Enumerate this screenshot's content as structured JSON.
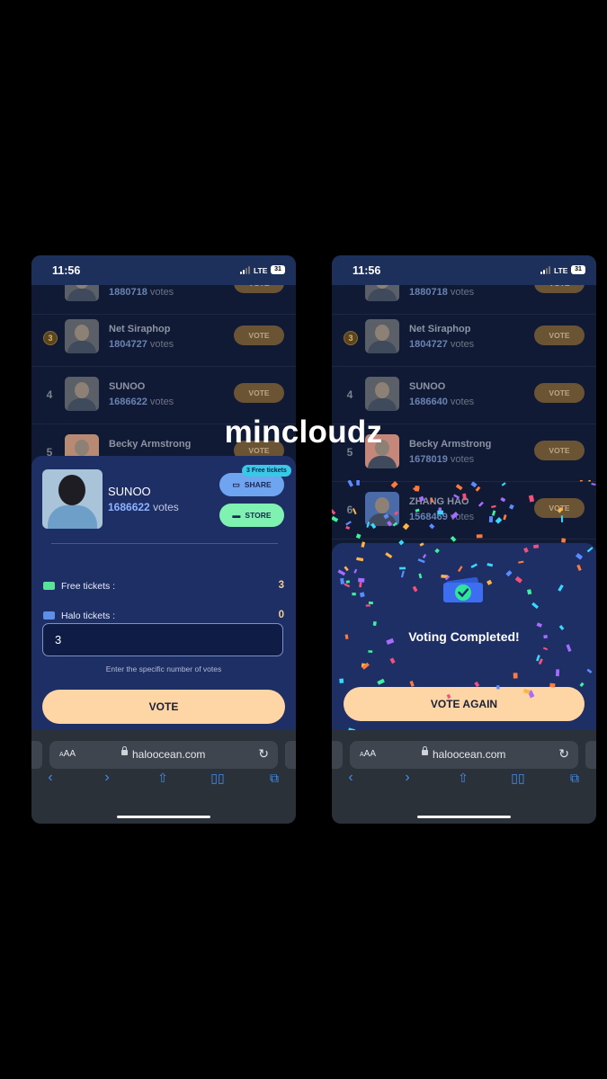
{
  "watermark": "mincloudz",
  "status": {
    "time": "11:56",
    "network": "LTE",
    "battery": "31"
  },
  "browser": {
    "aa_label": "AA",
    "url": "haloocean.com"
  },
  "left": {
    "list": [
      {
        "rank": "",
        "name": "",
        "votes": "1880718",
        "votes_suffix": "votes",
        "button": "VOTE"
      },
      {
        "rank": "3",
        "name": "Net Siraphop",
        "votes": "1804727",
        "votes_suffix": "votes",
        "button": "VOTE"
      },
      {
        "rank": "4",
        "name": "SUNOO",
        "votes": "1686622",
        "votes_suffix": "votes",
        "button": "VOTE"
      },
      {
        "rank": "5",
        "name": "Becky Armstrong",
        "votes": "",
        "votes_suffix": "",
        "button": "VOTE"
      }
    ],
    "sheet": {
      "name": "SUNOO",
      "votes": "1686622",
      "votes_suffix": "votes",
      "free_badge": "3 Free tickets",
      "share_label": "SHARE",
      "store_label": "STORE",
      "free_tickets_label": "Free tickets :",
      "free_tickets_value": "3",
      "halo_tickets_label": "Halo tickets :",
      "halo_tickets_value": "0",
      "input_value": "3",
      "hint": "Enter the specific number of votes",
      "vote_label": "VOTE"
    }
  },
  "right": {
    "list": [
      {
        "rank": "",
        "name": "",
        "votes": "1880718",
        "votes_suffix": "votes",
        "button": "VOTE"
      },
      {
        "rank": "3",
        "name": "Net Siraphop",
        "votes": "1804727",
        "votes_suffix": "votes",
        "button": "VOTE"
      },
      {
        "rank": "4",
        "name": "SUNOO",
        "votes": "1686640",
        "votes_suffix": "votes",
        "button": "VOTE"
      },
      {
        "rank": "5",
        "name": "Becky Armstrong",
        "votes": "1678019",
        "votes_suffix": "votes",
        "button": "VOTE"
      },
      {
        "rank": "6",
        "name": "ZHANG HAO",
        "votes": "1568469",
        "votes_suffix": "votes",
        "button": "VOTE"
      }
    ],
    "completed_text": "Voting Completed!",
    "vote_again_label": "VOTE AGAIN"
  },
  "colors": {
    "accent_button": "#fed5a5",
    "share": "#6fa5f0",
    "store": "#7ff2b2",
    "sheet": "#1e2f66"
  }
}
